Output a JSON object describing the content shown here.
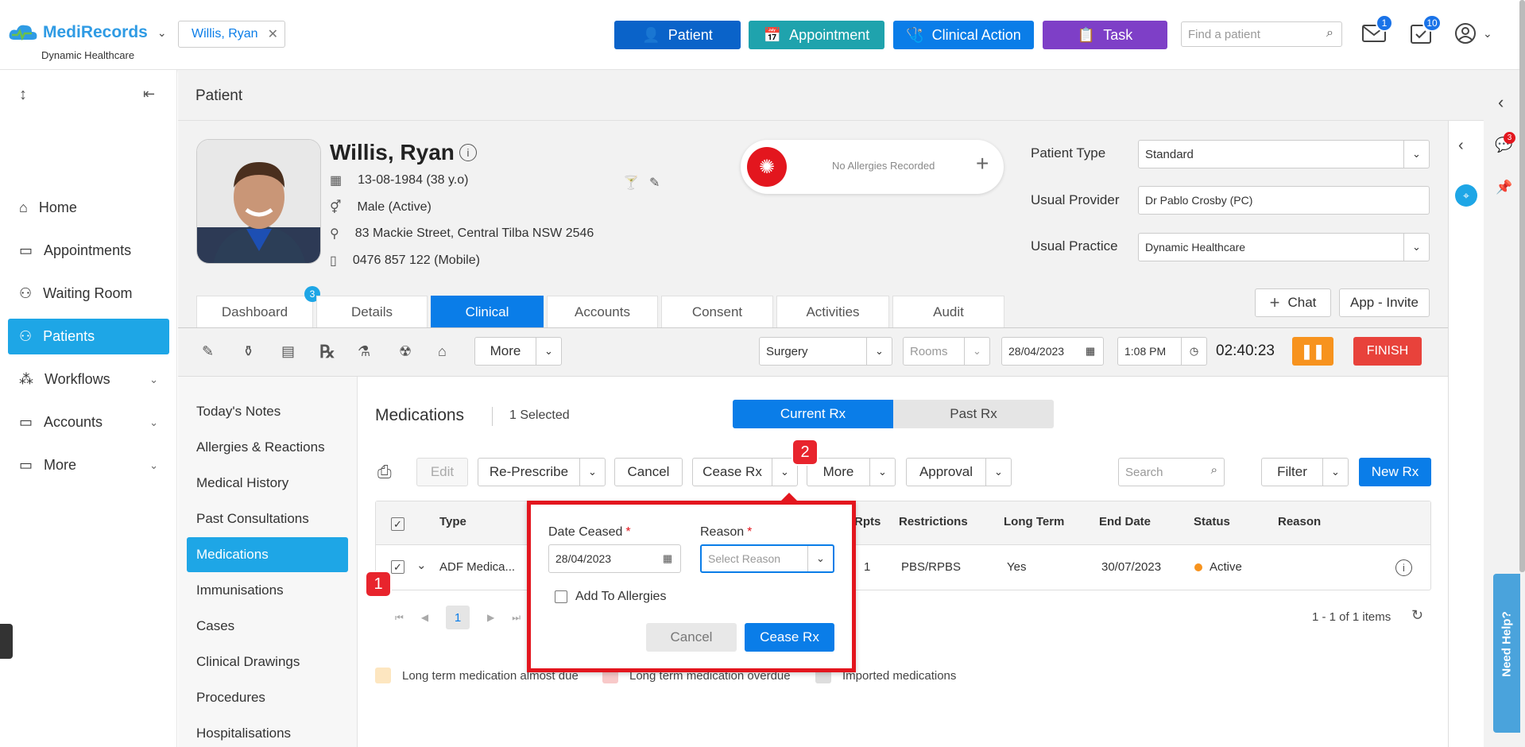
{
  "app": {
    "name": "MediRecords",
    "org": "Dynamic Healthcare"
  },
  "topbar": {
    "patient_chip": "Willis, Ryan",
    "buttons": {
      "patient": "Patient",
      "appointment": "Appointment",
      "clinical_action": "Clinical Action",
      "task": "Task"
    },
    "search_placeholder": "Find a patient",
    "mail_badge": "1",
    "tasks_badge": "10"
  },
  "sidebar": {
    "items": [
      {
        "label": "Home"
      },
      {
        "label": "Appointments"
      },
      {
        "label": "Waiting Room"
      },
      {
        "label": "Patients"
      },
      {
        "label": "Workflows"
      },
      {
        "label": "Accounts"
      },
      {
        "label": "More"
      }
    ]
  },
  "page": {
    "title": "Patient"
  },
  "patient": {
    "name": "Willis, Ryan",
    "dob": "13-08-1984 (38 y.o)",
    "gender": "Male (Active)",
    "address": "83 Mackie Street, Central Tilba NSW 2546",
    "phone": "0476 857 122 (Mobile)",
    "allergies": "No Allergies Recorded",
    "type_label": "Patient Type",
    "type_value": "Standard",
    "provider_label": "Usual Provider",
    "provider_value": "Dr Pablo Crosby (PC)",
    "practice_label": "Usual Practice",
    "practice_value": "Dynamic Healthcare"
  },
  "actions": {
    "chat": "Chat",
    "app_invite": "App - Invite"
  },
  "tabs": [
    {
      "label": "Dashboard",
      "badge": "3"
    },
    {
      "label": "Details"
    },
    {
      "label": "Clinical"
    },
    {
      "label": "Accounts"
    },
    {
      "label": "Consent"
    },
    {
      "label": "Activities"
    },
    {
      "label": "Audit"
    }
  ],
  "toolbar": {
    "more": "More",
    "surgery": "Surgery",
    "rooms_placeholder": "Rooms",
    "date": "28/04/2023",
    "time": "1:08 PM",
    "timer": "02:40:23",
    "finish": "FINISH"
  },
  "subnav": [
    {
      "label": "Today's Notes"
    },
    {
      "label": "Allergies & Reactions"
    },
    {
      "label": "Medical History"
    },
    {
      "label": "Past Consultations"
    },
    {
      "label": "Medications"
    },
    {
      "label": "Immunisations"
    },
    {
      "label": "Cases"
    },
    {
      "label": "Clinical Drawings"
    },
    {
      "label": "Procedures"
    },
    {
      "label": "Hospitalisations"
    }
  ],
  "medications": {
    "title": "Medications",
    "selected": "1 Selected",
    "toggle_current": "Current Rx",
    "toggle_past": "Past Rx",
    "buttons": {
      "edit": "Edit",
      "represcribe": "Re-Prescribe",
      "cancel": "Cancel",
      "cease": "Cease Rx",
      "more": "More",
      "approval": "Approval",
      "filter": "Filter",
      "new_rx": "New Rx"
    },
    "search_placeholder": "Search",
    "columns": [
      "Type",
      "Rpts",
      "Restrictions",
      "Long Term",
      "End Date",
      "Status",
      "Reason"
    ],
    "row": {
      "type": "ADF Medica...",
      "rpts": "1",
      "restrictions": "PBS/RPBS",
      "long_term": "Yes",
      "end_date": "30/07/2023",
      "status": "Active",
      "reason": ""
    },
    "pager_page": "1",
    "pager_info": "1 - 1 of 1 items",
    "legend": [
      "Long term medication almost due",
      "Long term medication overdue",
      "Imported medications"
    ]
  },
  "popover": {
    "date_label": "Date Ceased",
    "date_value": "28/04/2023",
    "reason_label": "Reason",
    "reason_placeholder": "Select Reason",
    "add_allergies": "Add To Allergies",
    "cancel": "Cancel",
    "cease": "Cease Rx"
  },
  "callouts": [
    "1",
    "2"
  ],
  "right_panel": {
    "notif_badge": "3",
    "help": "Need Help?"
  },
  "colors": {
    "patient_btn": "#0a63c9",
    "appointment_btn": "#1fa3ad",
    "clinical_btn": "#0a7de8",
    "task_btn": "#7e3fc7",
    "accent": "#1ea6e6",
    "finish": "#e8423b",
    "pause": "#f7931e",
    "highlight": "#e3161e"
  }
}
